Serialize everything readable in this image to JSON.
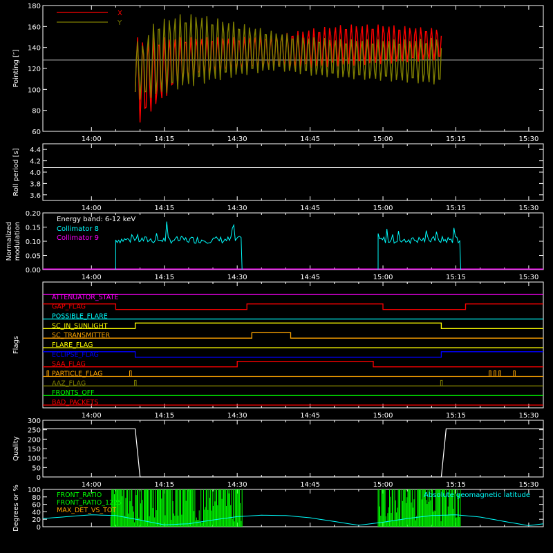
{
  "time_axis": {
    "range": [
      "13:50",
      "15:33"
    ],
    "ticks": [
      "14:00",
      "14:15",
      "14:30",
      "14:45",
      "15:00",
      "15:15",
      "15:30"
    ]
  },
  "colors": {
    "frame": "#ffffff",
    "x_series": "#ff0000",
    "y_series": "#808000",
    "roll_line": "#ffffff",
    "coll8": "#00ffff",
    "coll9": "#ff00ff",
    "quality": "#ffffff",
    "front_ratio": "#00ff00",
    "front_ratio_1225": "#00ff00",
    "max_det": "#ffa500",
    "geomag": "#00ffff"
  },
  "chart_data": [
    {
      "type": "area",
      "ylabel": "Pointing [″]",
      "ylim": [
        60,
        180
      ],
      "yticks": [
        "60",
        "80",
        "100",
        "120",
        "140",
        "160",
        "180"
      ],
      "legend": {
        "placement": "top-left",
        "entries": [
          "X",
          "Y"
        ]
      },
      "reference_line": 128,
      "series": [
        {
          "name": "X",
          "t": [
            "14:09",
            "14:10",
            "14:13",
            "14:18",
            "14:22",
            "14:30",
            "14:38",
            "14:45",
            "14:52",
            "15:00",
            "15:06",
            "15:12"
          ],
          "upper": [
            152,
            148,
            150,
            150,
            150,
            150,
            152,
            158,
            162,
            162,
            160,
            158
          ],
          "lower": [
            95,
            68,
            82,
            105,
            112,
            118,
            120,
            120,
            122,
            124,
            126,
            128
          ]
        },
        {
          "name": "Y",
          "t": [
            "14:09",
            "14:10",
            "14:13",
            "14:18",
            "14:22",
            "14:30",
            "14:38",
            "14:45",
            "14:52",
            "15:00",
            "15:06",
            "15:12"
          ],
          "upper": [
            152,
            140,
            165,
            172,
            172,
            164,
            155,
            150,
            148,
            148,
            148,
            150
          ],
          "lower": [
            95,
            90,
            92,
            100,
            104,
            112,
            118,
            113,
            110,
            108,
            106,
            104
          ]
        }
      ]
    },
    {
      "type": "line",
      "ylabel": "Roll period [s]",
      "ylim": [
        3.5,
        4.5
      ],
      "yticks": [
        "3.6",
        "3.8",
        "4.0",
        "4.2",
        "4.4"
      ],
      "series": [
        {
          "t": [
            "13:50",
            "15:33"
          ],
          "values": [
            4.08,
            4.08
          ]
        }
      ]
    },
    {
      "type": "line",
      "ylabel": "Normalized modulation",
      "ylim": [
        0,
        0.2
      ],
      "yticks": [
        "0.00",
        "0.05",
        "0.10",
        "0.15",
        "0.20"
      ],
      "legend": {
        "placement": "top-left",
        "title": "Energy band: 6-12 keV",
        "entries": [
          "Collimator 8",
          "Collimator 9"
        ]
      },
      "series": [
        {
          "name": "Collimator 8",
          "segments": [
            {
              "start": "14:05",
              "end": "14:31",
              "level": 0.105
            },
            {
              "start": "14:59",
              "end": "15:16",
              "level": 0.105
            }
          ]
        },
        {
          "name": "Collimator 9",
          "segments": [
            {
              "start": "13:50",
              "end": "15:33",
              "level": 0.002
            }
          ]
        }
      ]
    },
    {
      "type": "line",
      "ylabel": "Flags",
      "flags": [
        {
          "label": "ATTENUATOR_STATE",
          "color": "#ff00ff",
          "segments": [
            [
              "13:50",
              "15:33",
              1
            ]
          ]
        },
        {
          "label": "GAP_FLAG",
          "color": "#ff0000",
          "segments": [
            [
              "13:50",
              "14:05",
              1
            ],
            [
              "14:05",
              "14:32",
              0
            ],
            [
              "14:32",
              "15:00",
              1
            ],
            [
              "15:00",
              "15:17",
              0
            ],
            [
              "15:17",
              "15:33",
              1
            ]
          ]
        },
        {
          "label": "POSSIBLE_FLARE",
          "color": "#00ffff",
          "segments": [
            [
              "13:50",
              "15:33",
              0
            ]
          ]
        },
        {
          "label": "SC_IN_SUNLIGHT",
          "color": "#ffff00",
          "segments": [
            [
              "13:50",
              "14:09",
              0
            ],
            [
              "14:09",
              "15:12",
              1
            ],
            [
              "15:12",
              "15:33",
              0
            ]
          ]
        },
        {
          "label": "SC_TRANSMITTER",
          "color": "#ffa500",
          "segments": [
            [
              "13:50",
              "14:33",
              0
            ],
            [
              "14:33",
              "14:41",
              1
            ],
            [
              "14:41",
              "15:33",
              0
            ]
          ]
        },
        {
          "label": "FLARE_FLAG",
          "color": "#ffff00",
          "segments": [
            [
              "13:50",
              "15:33",
              0
            ]
          ]
        },
        {
          "label": "ECLIPSE_FLAG",
          "color": "#0000ff",
          "segments": [
            [
              "13:50",
              "14:09",
              1
            ],
            [
              "14:09",
              "15:12",
              0
            ],
            [
              "15:12",
              "15:33",
              1
            ]
          ]
        },
        {
          "label": "SAA_FLAG",
          "color": "#ff0000",
          "segments": [
            [
              "13:50",
              "14:30",
              0
            ],
            [
              "14:30",
              "14:58",
              1
            ],
            [
              "14:58",
              "15:33",
              0
            ]
          ]
        },
        {
          "label": "PARTICLE_FLAG",
          "color": "#ffa500",
          "segments": [
            [
              "13:50",
              "15:33",
              0
            ]
          ],
          "spikes": [
            "13:51",
            "14:08",
            "15:22",
            "15:23",
            "15:24",
            "15:27"
          ]
        },
        {
          "label": "AAZ_FLAG",
          "color": "#808000",
          "segments": [
            [
              "13:50",
              "15:33",
              0
            ]
          ],
          "spikes": [
            "14:09",
            "15:12"
          ]
        },
        {
          "label": "FRONTS_OFF",
          "color": "#00ff00",
          "segments": [
            [
              "13:50",
              "15:33",
              0
            ]
          ]
        },
        {
          "label": "BAD_PACKETS",
          "color": "#ff0000",
          "segments": [
            [
              "13:50",
              "15:33",
              0
            ]
          ]
        }
      ]
    },
    {
      "type": "line",
      "ylabel": "Quality",
      "ylim": [
        0,
        300
      ],
      "yticks": [
        "0",
        "50",
        "100",
        "150",
        "200",
        "250",
        "300"
      ],
      "series": [
        {
          "t": [
            "13:50",
            "14:09",
            "14:10",
            "15:12",
            "15:13",
            "15:33"
          ],
          "values": [
            255,
            255,
            0,
            0,
            255,
            255
          ]
        }
      ]
    },
    {
      "type": "line",
      "ylabel": "Degrees or %",
      "ylim": [
        0,
        100
      ],
      "yticks": [
        "0",
        "20",
        "40",
        "60",
        "80",
        "100"
      ],
      "legend": {
        "placement": "top-left",
        "entries": [
          "FRONT_RATIO",
          "FRONT_RATIO_1225",
          "MAX_DET_VS_TOT"
        ],
        "right_label": "Absolute geomagnetic latitude"
      },
      "bands": [
        {
          "start": "14:04",
          "end": "14:31"
        },
        {
          "start": "14:59",
          "end": "15:16"
        }
      ],
      "geomag": {
        "t": [
          "13:50",
          "14:00",
          "14:05",
          "14:10",
          "14:15",
          "14:20",
          "14:25",
          "14:30",
          "14:35",
          "14:40",
          "14:45",
          "14:50",
          "14:55",
          "15:00",
          "15:05",
          "15:10",
          "15:15",
          "15:20",
          "15:25",
          "15:30",
          "15:33"
        ],
        "values": [
          22,
          32,
          30,
          18,
          5,
          8,
          18,
          27,
          31,
          30,
          24,
          14,
          4,
          12,
          22,
          30,
          32,
          26,
          14,
          3,
          8
        ]
      }
    }
  ]
}
